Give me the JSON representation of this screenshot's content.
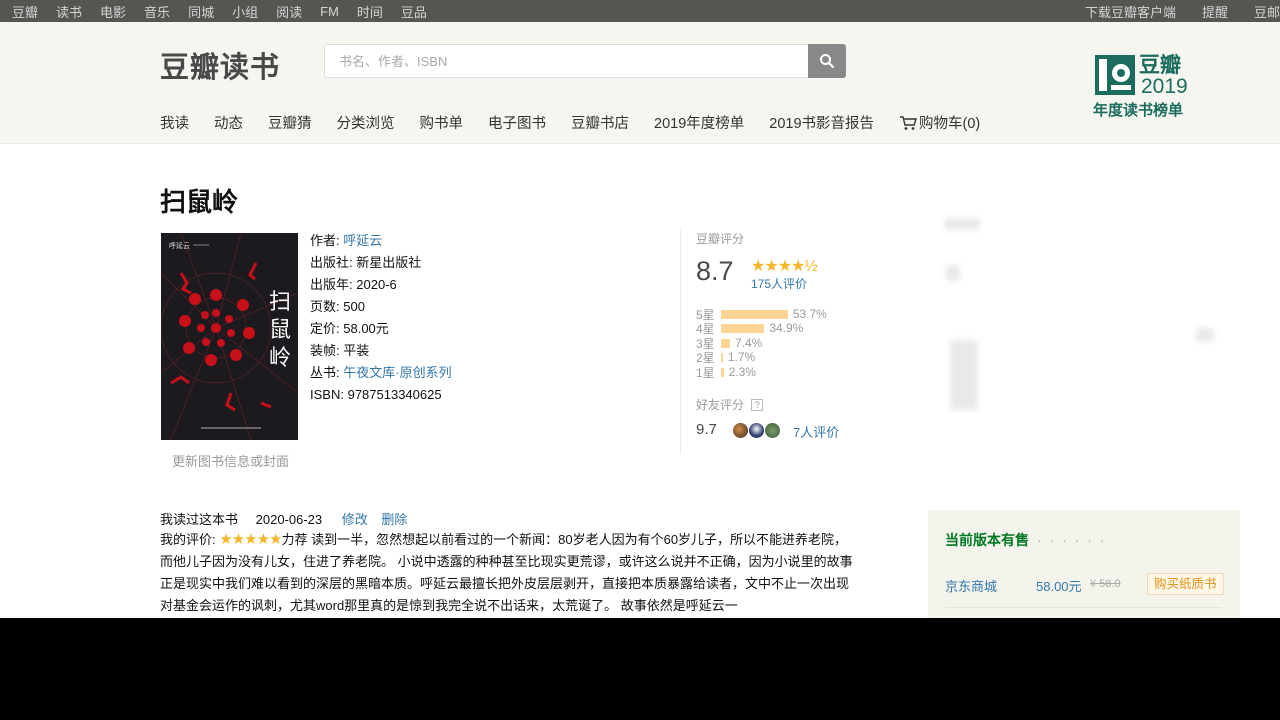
{
  "global_nav": {
    "left": [
      "豆瓣",
      "读书",
      "电影",
      "音乐",
      "同城",
      "小组",
      "阅读",
      "FM",
      "时间",
      "豆品"
    ],
    "right": [
      "下载豆瓣客户端",
      "提醒",
      "豆邮"
    ]
  },
  "header": {
    "logo": "豆瓣读书",
    "search_placeholder": "书名、作者、ISBN",
    "badge": {
      "line1": "豆瓣",
      "line2": "2019",
      "line3": "年度读书榜单"
    }
  },
  "sub_nav": [
    "我读",
    "动态",
    "豆瓣猜",
    "分类浏览",
    "购书单",
    "电子图书",
    "豆瓣书店",
    "2019年度榜单",
    "2019书影音报告"
  ],
  "cart_label": "购物车(0)",
  "book": {
    "title": "扫鼠岭",
    "cover_text": {
      "author": "呼延云",
      "title_chars": [
        "扫",
        "鼠",
        "岭"
      ]
    },
    "update_link": "更新图书信息或封面",
    "info": [
      {
        "label": "作者:",
        "value": "呼延云",
        "link": true
      },
      {
        "label": "出版社:",
        "value": "新星出版社",
        "link": false
      },
      {
        "label": "出版年:",
        "value": "2020-6",
        "link": false
      },
      {
        "label": "页数:",
        "value": "500",
        "link": false
      },
      {
        "label": "定价:",
        "value": "58.00元",
        "link": false
      },
      {
        "label": "装帧:",
        "value": "平装",
        "link": false
      },
      {
        "label": "丛书:",
        "value": "午夜文库·原创系列",
        "link": true
      },
      {
        "label": "ISBN:",
        "value": "9787513340625",
        "link": false
      }
    ]
  },
  "rating": {
    "label": "豆瓣评分",
    "score": "8.7",
    "stars": "★★★★½",
    "count": "175人评价",
    "distribution": [
      {
        "star": "5星",
        "pct": "53.7%",
        "value": 53.7
      },
      {
        "star": "4星",
        "pct": "34.9%",
        "value": 34.9
      },
      {
        "star": "3星",
        "pct": "7.4%",
        "value": 7.4
      },
      {
        "star": "2星",
        "pct": "1.7%",
        "value": 1.7
      },
      {
        "star": "1星",
        "pct": "2.3%",
        "value": 2.3
      }
    ],
    "friend_label": "好友评分",
    "friend_score": "9.7",
    "friend_count": "7人评价",
    "colors": {
      "star": "#f7b629",
      "bar": "#ffd596"
    }
  },
  "my_review": {
    "status": "我读过这本书",
    "date": "2020-06-23",
    "edit": "修改",
    "delete": "删除",
    "label": "我的评价:",
    "stars": "★★★★★",
    "recommend": "力荐",
    "text": "读到一半，忽然想起以前看过的一个新闻：80岁老人因为有个60岁儿子，所以不能进养老院，而他儿子因为没有儿女，住进了养老院。 小说中透露的种种甚至比现实更荒谬，或许这么说并不正确，因为小说里的故事正是现实中我们难以看到的深层的黑暗本质。呼延云最擅长把外皮层层剥开，直接把本质暴露给读者，文中不止一次出现对基金会运作的讽刺，尤其word那里真的是惊到我完全说不出话来，太荒诞了。 故事依然是呼延云一"
  },
  "buy_box": {
    "title": "当前版本有售",
    "dots": "· · · · · ·",
    "store": "京东商城",
    "price": "58.00元",
    "old_price": "¥ 58.0",
    "button": "购买纸质书"
  }
}
